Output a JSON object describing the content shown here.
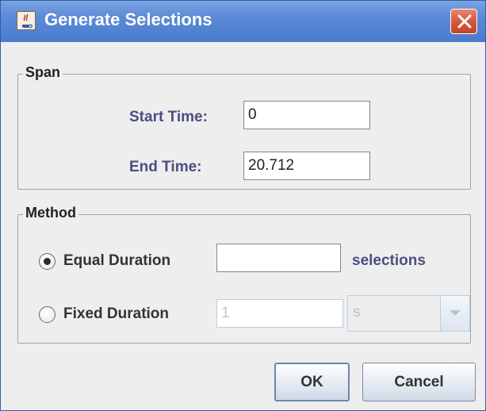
{
  "window": {
    "title": "Generate Selections",
    "app_icon": "java-coffee-cup-icon",
    "close_icon": "close-x-icon"
  },
  "span": {
    "legend": "Span",
    "start_time_label": "Start Time:",
    "start_time_value": "0",
    "end_time_label": "End Time:",
    "end_time_value": "20.712"
  },
  "method": {
    "legend": "Method",
    "equal_duration": {
      "label": "Equal Duration",
      "selected": true,
      "value": "",
      "unit_label": "selections"
    },
    "fixed_duration": {
      "label": "Fixed Duration",
      "selected": false,
      "value": "1",
      "unit_value": "s",
      "enabled": false
    }
  },
  "buttons": {
    "ok_label": "OK",
    "cancel_label": "Cancel"
  },
  "colors": {
    "titlebar": "#5b8ad6",
    "label_accent": "#4b4e80",
    "close_button": "#d5583d"
  }
}
